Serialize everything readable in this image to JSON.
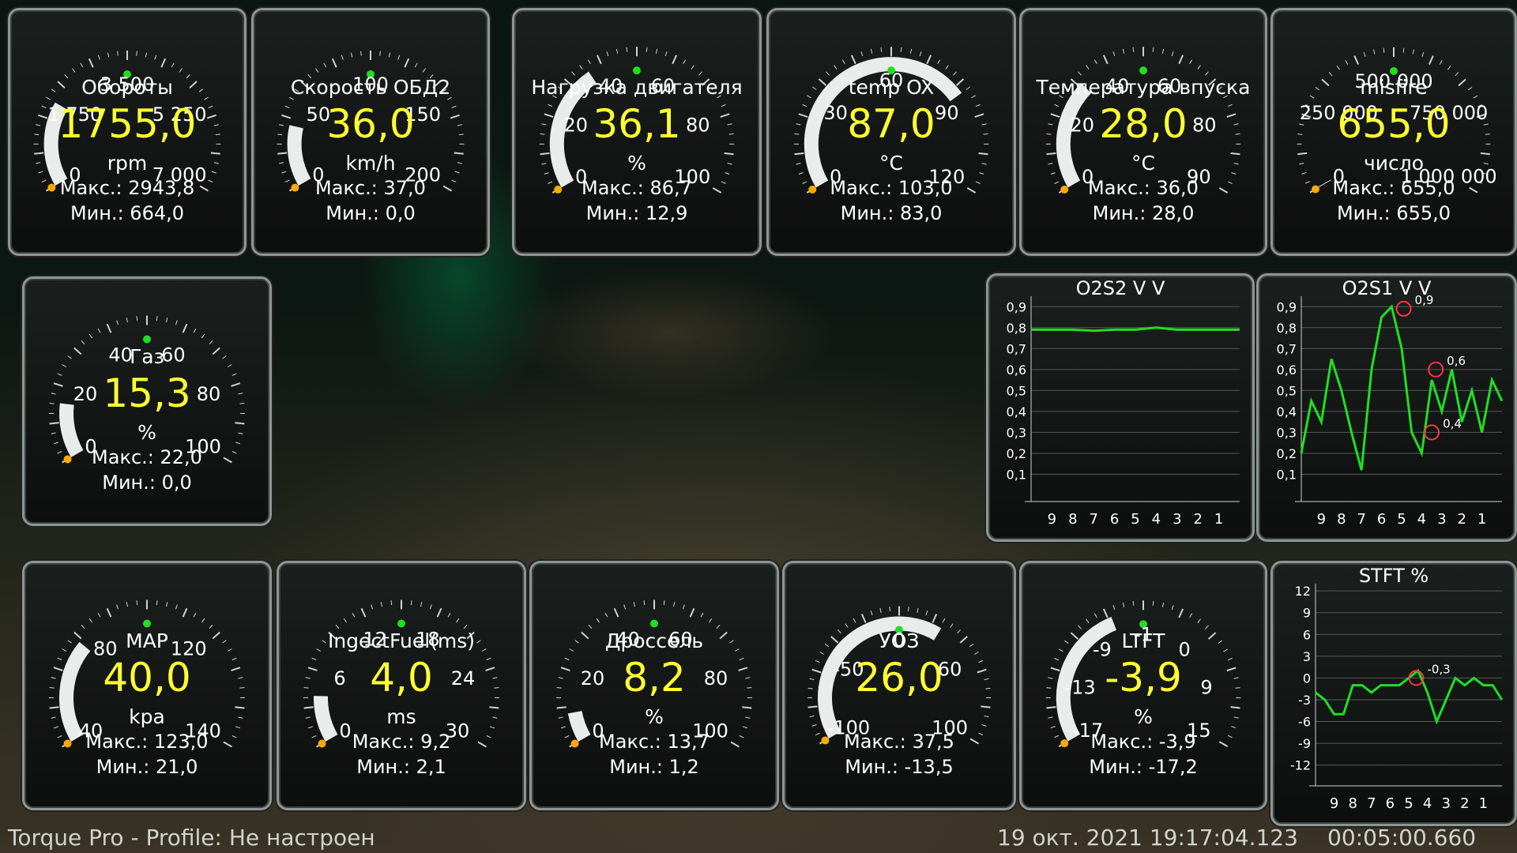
{
  "footer": {
    "profile": "Torque Pro - Profile: Не настроен",
    "datetime": "19 окт. 2021 19:17:04.123",
    "elapsed": "00:05:00.660"
  },
  "gauges": [
    {
      "id": "rpm",
      "title": "Обороты",
      "value": "1755,0",
      "unit": "rpm",
      "max": "Макс.: 2943,8",
      "min": "Мин.: 664,0",
      "ticks": [
        "0",
        "1 750",
        "3 500",
        "5 250",
        "7 000"
      ],
      "level": 0.25
    },
    {
      "id": "speed",
      "title": "Скорость ОБД2",
      "value": "36,0",
      "unit": "km/h",
      "max": "Макс.: 37,0",
      "min": "Мин.: 0,0",
      "ticks": [
        "0",
        "50",
        "100",
        "150",
        "200"
      ],
      "level": 0.18
    },
    {
      "id": "load",
      "title": "Нагрузка двигателя",
      "value": "36,1",
      "unit": "%",
      "max": "Макс.: 86,7",
      "min": "Мин.: 12,9",
      "ticks": [
        "0",
        "20",
        "40",
        "60",
        "80",
        "100"
      ],
      "level": 0.36
    },
    {
      "id": "temp",
      "title": "temp OX",
      "value": "87,0",
      "unit": "°C",
      "max": "Макс.: 103,0",
      "min": "Мин.: 83,0",
      "ticks": [
        "0",
        "30",
        "60",
        "90",
        "120"
      ],
      "level": 0.725
    },
    {
      "id": "intake",
      "title": "Температура впуска",
      "value": "28,0",
      "unit": "°C",
      "max": "Макс.: 36,0",
      "min": "Мин.: 28,0",
      "ticks": [
        "0",
        "20",
        "40",
        "60",
        "80",
        "90"
      ],
      "level": 0.31
    },
    {
      "id": "misfire",
      "title": "misfire",
      "value": "655,0",
      "unit": "число",
      "max": "Макс.: 655,0",
      "min": "Мин.: 655,0",
      "ticks": [
        "0",
        "250 000",
        "500 000",
        "750 000",
        "1 000 000"
      ],
      "level": 0.001
    },
    {
      "id": "gas",
      "title": "Газ",
      "value": "15,3",
      "unit": "%",
      "max": "Макс.: 22,0",
      "min": "Мин.: 0,0",
      "ticks": [
        "0",
        "20",
        "40",
        "60",
        "80",
        "100"
      ],
      "level": 0.153
    },
    {
      "id": "map",
      "title": "MAP",
      "value": "40,0",
      "unit": "kpa",
      "max": "Макс.: 123,0",
      "min": "Мин.: 21,0",
      "ticks": [
        "40",
        "80",
        "120",
        "140"
      ],
      "level": 0.29
    },
    {
      "id": "inject",
      "title": "IngectFuel(ms)",
      "value": "4,0",
      "unit": "ms",
      "max": "Макс.: 9,2",
      "min": "Мин.: 2,1",
      "ticks": [
        "0",
        "6",
        "12",
        "18",
        "24",
        "30"
      ],
      "level": 0.13
    },
    {
      "id": "throttle",
      "title": "Дроссель",
      "value": "8,2",
      "unit": "%",
      "max": "Макс.: 13,7",
      "min": "Мин.: 1,2",
      "ticks": [
        "0",
        "20",
        "40",
        "60",
        "80",
        "100"
      ],
      "level": 0.082
    },
    {
      "id": "uoz",
      "title": "УОЗ",
      "value": "26,0",
      "unit": "",
      "max": "Макс.: 37,5",
      "min": "Мин.: -13,5",
      "ticks": [
        "-100",
        "-50",
        "0",
        "60",
        "100"
      ],
      "level": 0.63
    },
    {
      "id": "ltft",
      "title": "LTFT",
      "value": "-3,9",
      "unit": "%",
      "max": "Макс.: -3,9",
      "min": "Мин.: -17,2",
      "ticks": [
        "-17",
        "-13",
        "-9",
        "-1",
        "0",
        "9",
        "15"
      ],
      "level": 0.41
    }
  ],
  "chart_data": [
    {
      "type": "line",
      "title": "O2S2 V  V",
      "x": [
        10,
        9,
        8,
        7,
        6,
        5,
        4,
        3,
        2,
        1,
        0
      ],
      "x_tick_labels": [
        "9",
        "8",
        "7",
        "6",
        "5",
        "4",
        "3",
        "2",
        "1"
      ],
      "y_tick_labels": [
        "0,9",
        "0,8",
        "0,7",
        "0,6",
        "0,5",
        "0,4",
        "0,3",
        "0,2",
        "0,1"
      ],
      "ylim": [
        0,
        0.95
      ],
      "series": [
        {
          "values": [
            0.79,
            0.79,
            0.79,
            0.785,
            0.79,
            0.79,
            0.8,
            0.79,
            0.79,
            0.79,
            0.79
          ]
        }
      ],
      "annotations": []
    },
    {
      "type": "line",
      "title": "O2S1 V  V",
      "x": [
        10,
        9.5,
        9,
        8.5,
        8,
        7.5,
        7,
        6.5,
        6,
        5.5,
        5,
        4.5,
        4,
        3.5,
        3,
        2.5,
        2,
        1.5,
        1,
        0.5,
        0
      ],
      "x_tick_labels": [
        "9",
        "8",
        "7",
        "6",
        "5",
        "4",
        "3",
        "2",
        "1"
      ],
      "y_tick_labels": [
        "0,9",
        "0,8",
        "0,7",
        "0,6",
        "0,5",
        "0,4",
        "0,3",
        "0,2",
        "0,1"
      ],
      "ylim": [
        0,
        0.95
      ],
      "series": [
        {
          "values": [
            0.2,
            0.45,
            0.35,
            0.65,
            0.5,
            0.3,
            0.12,
            0.6,
            0.85,
            0.9,
            0.7,
            0.3,
            0.2,
            0.55,
            0.4,
            0.6,
            0.35,
            0.5,
            0.3,
            0.55,
            0.45
          ]
        }
      ],
      "annotations": [
        {
          "label": "0,9",
          "x": 4.9,
          "y": 0.89
        },
        {
          "label": "0,6",
          "x": 3.3,
          "y": 0.6
        },
        {
          "label": "0,4",
          "x": 3.5,
          "y": 0.3
        }
      ]
    },
    {
      "type": "line",
      "title": "STFT  %",
      "x": [
        10,
        9.5,
        9,
        8.5,
        8,
        7.5,
        7,
        6.5,
        6,
        5.5,
        5,
        4.5,
        4,
        3.5,
        3,
        2.5,
        2,
        1.5,
        1,
        0.5,
        0
      ],
      "x_tick_labels": [
        "9",
        "8",
        "7",
        "6",
        "5",
        "4",
        "3",
        "2",
        "1"
      ],
      "y_tick_labels": [
        "12",
        "9",
        "6",
        "3",
        "0",
        "-3",
        "-6",
        "-9",
        "-12"
      ],
      "ylim": [
        -14,
        13
      ],
      "series": [
        {
          "values": [
            -2,
            -3,
            -5,
            -5,
            -1,
            -1,
            -2,
            -1,
            -1,
            -1,
            0,
            1,
            -2,
            -6,
            -3,
            0,
            -1,
            0,
            -1,
            -1,
            -3
          ]
        }
      ],
      "annotations": [
        {
          "label": "-0,3",
          "x": 4.6,
          "y": 0.0
        }
      ]
    }
  ],
  "colors": {
    "value": "#ffff33",
    "trace": "#22dd22",
    "needle": "#ff3344",
    "frame": "#8e9693"
  }
}
